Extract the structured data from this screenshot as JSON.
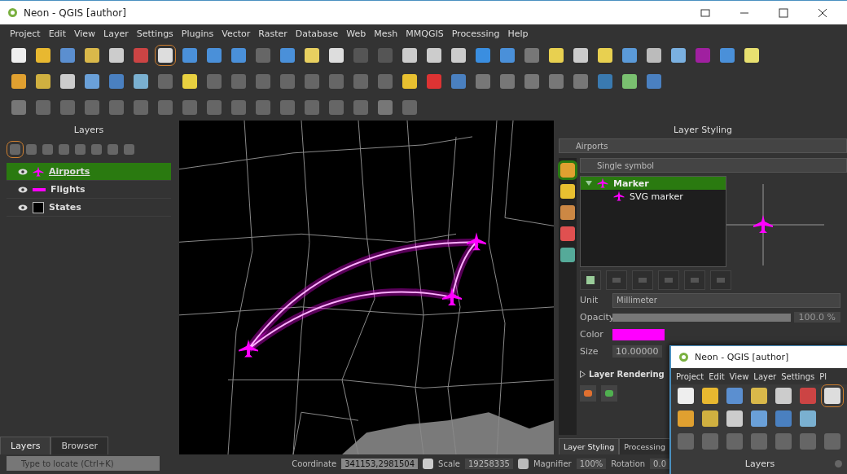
{
  "window": {
    "title": "Neon - QGIS [author]"
  },
  "menu": [
    "Project",
    "Edit",
    "View",
    "Layer",
    "Settings",
    "Plugins",
    "Vector",
    "Raster",
    "Database",
    "Web",
    "Mesh",
    "MMQGIS",
    "Processing",
    "Help"
  ],
  "layers_panel": {
    "title": "Layers",
    "layers": [
      {
        "name": "Airports",
        "kind": "point",
        "color": "#ff00ff",
        "visible": true,
        "selected": true
      },
      {
        "name": "Flights",
        "kind": "line",
        "color": "#ff00ff",
        "visible": true,
        "selected": false
      },
      {
        "name": "States",
        "kind": "polygon",
        "color": "#000000",
        "visible": true,
        "selected": false
      }
    ],
    "tabs": [
      {
        "label": "Layers",
        "selected": true
      },
      {
        "label": "Browser",
        "selected": false
      }
    ]
  },
  "styling_panel": {
    "title": "Layer Styling",
    "layer": "Airports",
    "renderer": "Single symbol",
    "symbol_tree": [
      {
        "label": "Marker",
        "selected": true,
        "expanded": true,
        "children": [
          {
            "label": "SVG marker",
            "selected": false
          }
        ]
      }
    ],
    "unit": {
      "label": "Unit",
      "value": "Millimeter"
    },
    "opacity": {
      "label": "Opacity",
      "level": 1,
      "reading": "100.0 %"
    },
    "color": {
      "label": "Color",
      "color": "#ff00ff"
    },
    "size": {
      "label": "Size",
      "value": "10.00000"
    },
    "section": "Layer Rendering",
    "tabs": [
      {
        "label": "Layer Styling",
        "selected": true
      },
      {
        "label": "Processing",
        "selected": false
      }
    ]
  },
  "status_bar": {
    "locate_placeholder": "Type to locate (Ctrl+K)",
    "coordinate_label": "Coordinate",
    "coordinate": "341153,2981504",
    "scale_label": "Scale",
    "scale": "19258335",
    "magnifier_label": "Magnifier",
    "magnifier": "100%",
    "rotation_label": "Rotation",
    "rotation": "0.0"
  },
  "overlay_window": {
    "title": "Neon - QGIS [author]",
    "menu": [
      "Project",
      "Edit",
      "View",
      "Layer",
      "Settings",
      "Pl"
    ],
    "panel_title": "Layers"
  }
}
